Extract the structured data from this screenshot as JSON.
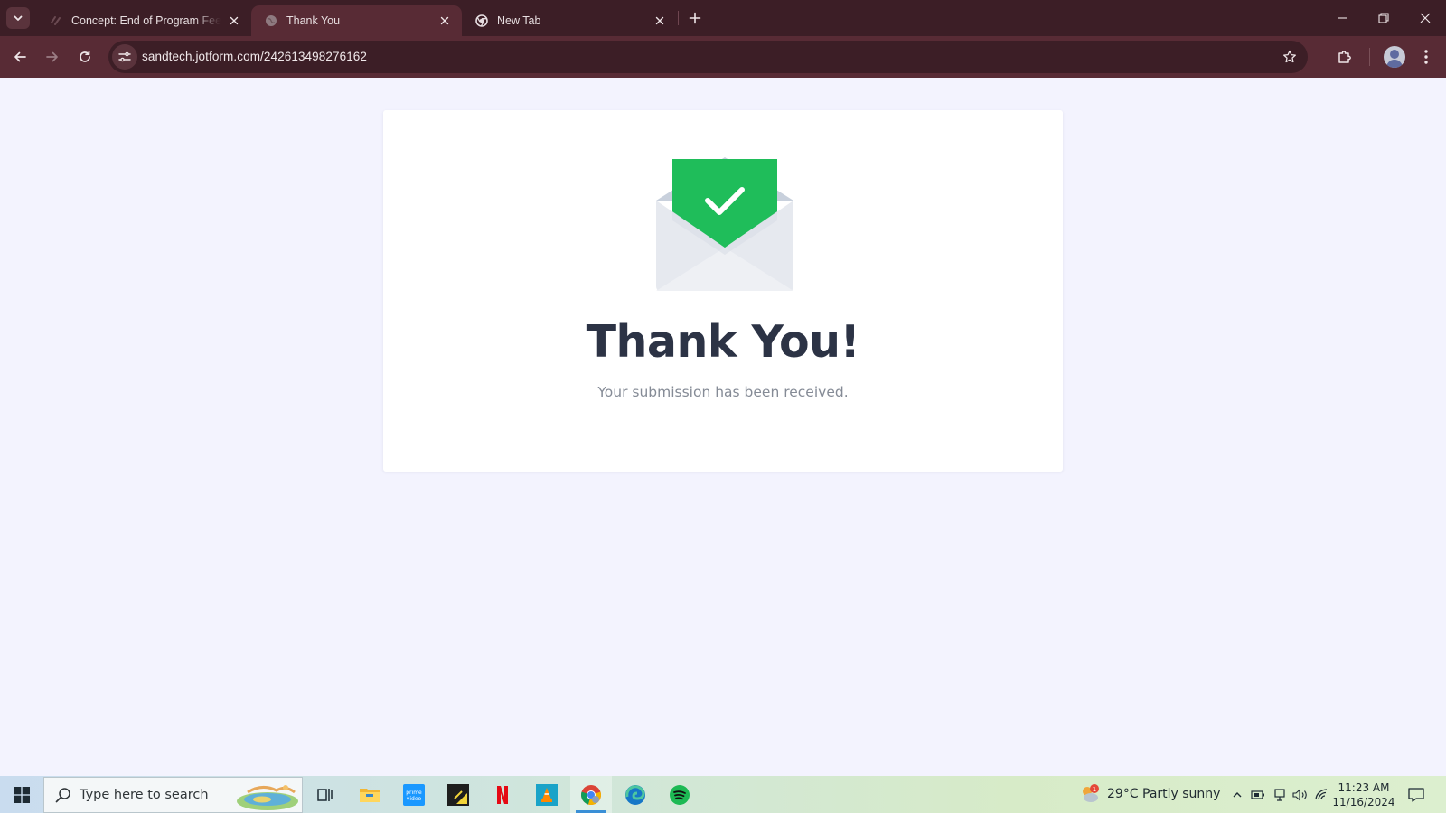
{
  "browser": {
    "tabs": [
      {
        "title": "Concept: End of Program Feedb",
        "active": false
      },
      {
        "title": "Thank You",
        "active": true
      },
      {
        "title": "New Tab",
        "active": false
      }
    ],
    "address": "sandtech.jotform.com/242613498276162"
  },
  "page": {
    "heading": "Thank You!",
    "message": "Your submission has been received.",
    "icon": "envelope-checkmark-icon",
    "accent_color": "#1fbd5a"
  },
  "taskbar": {
    "search_placeholder": "Type here to search",
    "apps": [
      "task-view",
      "file-explorer",
      "prime-video",
      "sticky-notes",
      "netflix",
      "vlc",
      "chrome",
      "edge",
      "spotify"
    ],
    "weather": {
      "temp": "29°C",
      "condition": "Partly sunny",
      "badge": "1"
    },
    "clock": {
      "time": "11:23 AM",
      "date": "11/16/2024"
    }
  }
}
